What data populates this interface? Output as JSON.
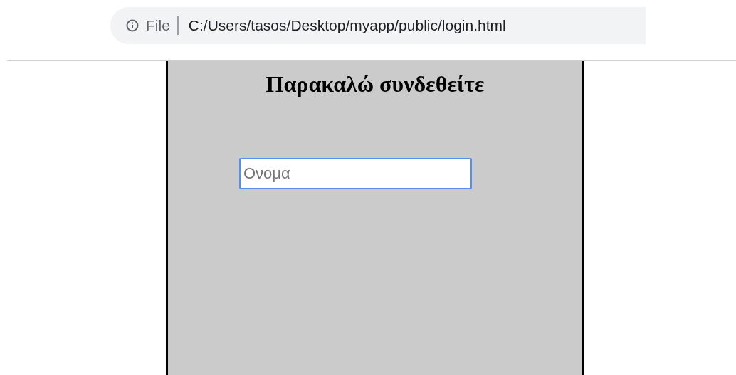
{
  "address_bar": {
    "scheme": "File",
    "url": "C:/Users/tasos/Desktop/myapp/public/login.html"
  },
  "login_panel": {
    "title": "Παρακαλώ συνδεθείτε",
    "name_field": {
      "placeholder": "Ονομα",
      "focused": true
    }
  }
}
